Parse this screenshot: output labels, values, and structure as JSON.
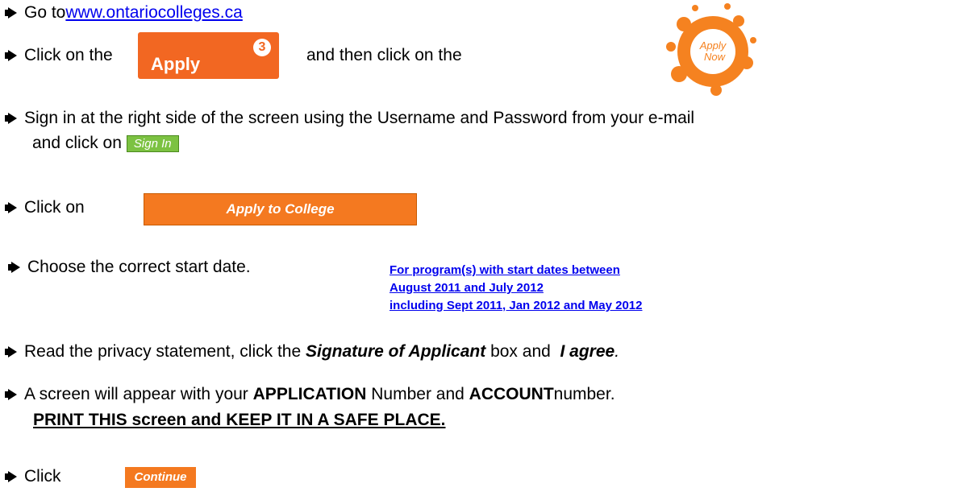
{
  "steps": {
    "s1": {
      "prefix": "Go to ",
      "link": "www.ontariocolleges.ca"
    },
    "s2": {
      "prefix": "Click on the",
      "suffix": "and then click on the"
    },
    "s3": {
      "line1": "Sign in at the right side of the screen using the Username and Password from your e-mail",
      "line2": "and click on"
    },
    "s4": {
      "prefix": "Click on"
    },
    "s5": {
      "prefix": "Choose the correct start date."
    },
    "s6": {
      "prefix": "Read the privacy statement, click the ",
      "bold1": "Signature of Applicant",
      "middle": " box and  ",
      "bold2": "I agree",
      "end": "."
    },
    "s7": {
      "p1": "A screen will appear with your ",
      "b1": "APPLICATION",
      "p2": " Number and ",
      "b2": "ACCOUNT",
      "p3": " number.",
      "line2": "PRINT THIS screen and KEEP IT IN A SAFE PLACE."
    },
    "s8": {
      "prefix": "Click"
    }
  },
  "buttons": {
    "apply": "Apply",
    "apply_badge": "3",
    "apply_now_line1": "Apply",
    "apply_now_line2": "Now",
    "sign_in": "Sign In",
    "apply_college": "Apply to College",
    "continue": "Continue"
  },
  "start_dates": [
    "For program(s) with start dates between",
    "August 2011 and July 2012",
    "including Sept 2011, Jan 2012 and May 2012"
  ],
  "colors": {
    "orange": "#f26722",
    "green": "#7cc242",
    "link": "#0000ee"
  }
}
